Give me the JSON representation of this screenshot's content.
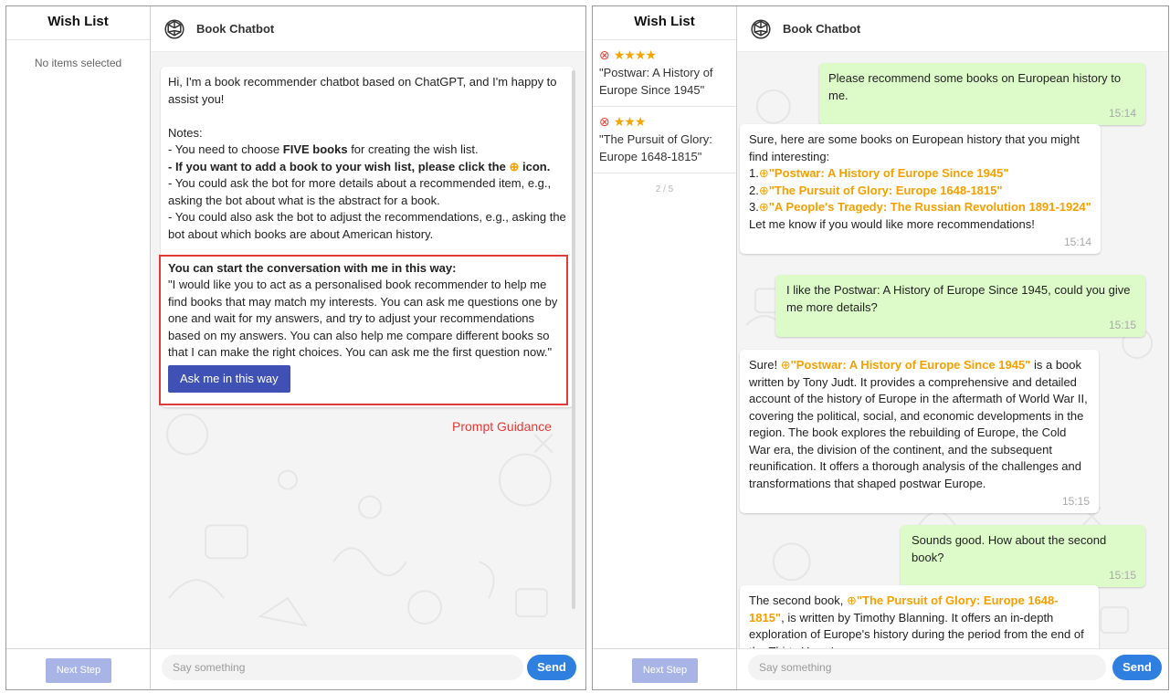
{
  "left": {
    "wishlist": {
      "title": "Wish List",
      "empty": "No items selected",
      "next_step": "Next Step"
    },
    "chat": {
      "title": "Book Chatbot",
      "greeting": "Hi, I'm a book recommender chatbot based on ChatGPT, and I'm happy to assist you!",
      "notes_heading": "Notes:",
      "note1_pre": "- You need to choose ",
      "note1_bold": "FIVE books",
      "note1_post": " for creating the wish list.",
      "note2_pre": "- If you want to add a book to your wish list, please click the ",
      "note2_post": " icon.",
      "note3": "- You could ask the bot for more details about a recommended item, e.g., asking the bot about what is the abstract for a book.",
      "note4": "- You could also ask the bot to adjust the recommendations, e.g., asking the bot about which books are about American history.",
      "guidance_heading": "You can start the conversation with me in this way:",
      "guidance_text": "\"I would like you to act as a personalised book recommender to help me find books that may match my interests. You can ask me questions one by one and wait for my answers, and try to adjust your recommendations based on my answers. You can also help me compare different books so that I can make the right choices. You can ask me the first question now.\"",
      "ask_button": "Ask me in this way",
      "guidance_label": "Prompt Guidance",
      "input_placeholder": "Say something",
      "send": "Send"
    }
  },
  "right": {
    "wishlist": {
      "title": "Wish List",
      "items": [
        {
          "rating": 4,
          "stars": "★★★★",
          "title": "\"Postwar: A History of Europe Since 1945\""
        },
        {
          "rating": 3,
          "stars": "★★★",
          "title": "\"The Pursuit of Glory: Europe 1648-1815\""
        }
      ],
      "pager": "2 / 5",
      "next_step": "Next Step"
    },
    "chat": {
      "title": "Book Chatbot",
      "messages": [
        {
          "role": "user",
          "text": "Please recommend some books on European history to me.",
          "time": "15:14"
        },
        {
          "role": "bot",
          "intro": "Sure, here are some books on European history that you might find interesting:",
          "items": [
            {
              "num": "1.",
              "title": "\"Postwar: A History of Europe Since 1945\""
            },
            {
              "num": "2.",
              "title": "\"The Pursuit of Glory: Europe 1648-1815\""
            },
            {
              "num": "3.",
              "title": "\"A People's Tragedy: The Russian Revolution 1891-1924\""
            }
          ],
          "outro": "Let me know if you would like more recommendations!",
          "time": "15:14"
        },
        {
          "role": "user",
          "text": "I like the Postwar: A History of Europe Since 1945, could you give me more details?",
          "time": "15:15"
        },
        {
          "role": "bot",
          "pre": "Sure! ",
          "title": "\"Postwar: A History of Europe Since 1945\"",
          "post": " is a book written by Tony Judt. It provides a comprehensive and detailed account of the history of Europe in the aftermath of World War II, covering the political, social, and economic developments in the region. The book explores the rebuilding of Europe, the Cold War era, the division of the continent, and the subsequent reunification. It offers a thorough analysis of the challenges and transformations that shaped postwar Europe.",
          "time": "15:15"
        },
        {
          "role": "user",
          "text": "Sounds good. How about the second book?",
          "time": "15:15"
        },
        {
          "role": "bot",
          "pre": "The second book, ",
          "title": "\"The Pursuit of Glory: Europe 1648-1815\"",
          "post": ", is written by Timothy Blanning. It offers an in-depth exploration of Europe's history during the period from the end of the Thirty Years'"
        }
      ],
      "input_placeholder": "Say something",
      "send": "Send"
    }
  },
  "icons": {
    "bot": "openai-logo-icon",
    "add": "plus-circle-icon",
    "remove": "x-circle-icon",
    "star": "star-icon"
  },
  "colors": {
    "user_bubble": "#ddfbc9",
    "highlight": "#f5a000",
    "send": "#2f7fe0",
    "ask_button": "#3f51b5",
    "guidance_border": "#e03b3b",
    "remove": "#e0463a"
  }
}
